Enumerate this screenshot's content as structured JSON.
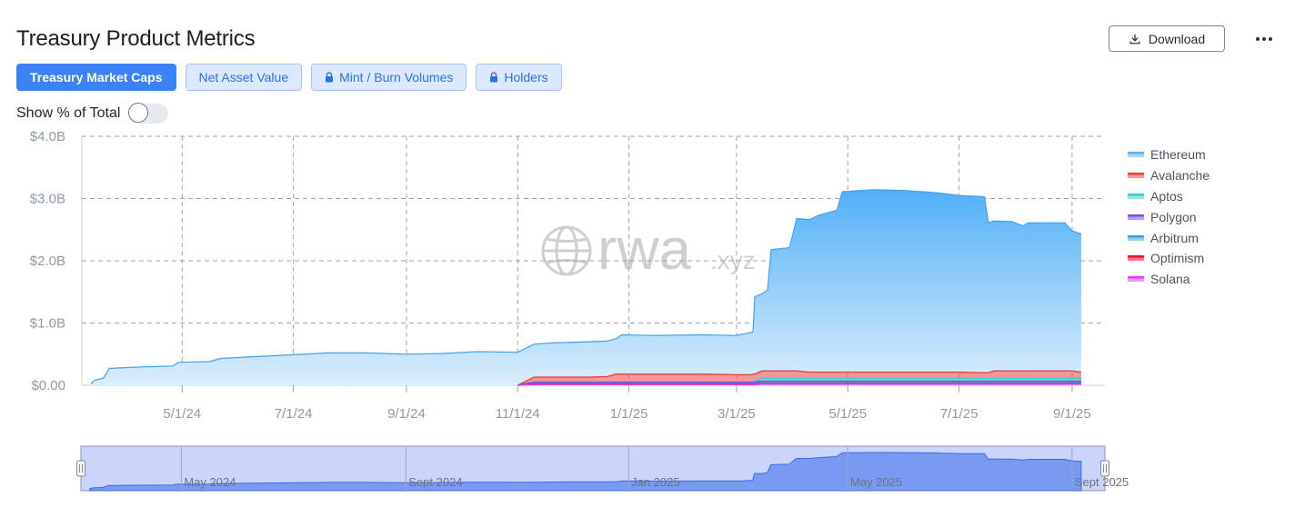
{
  "header": {
    "title": "Treasury Product Metrics",
    "download_label": "Download"
  },
  "tabs": [
    {
      "label": "Treasury Market Caps",
      "active": true,
      "locked": false
    },
    {
      "label": "Net Asset Value",
      "active": false,
      "locked": false
    },
    {
      "label": "Mint / Burn Volumes",
      "active": false,
      "locked": true
    },
    {
      "label": "Holders",
      "active": false,
      "locked": true
    }
  ],
  "toggle": {
    "label": "Show % of Total",
    "on": false
  },
  "watermark": {
    "main": "rwa",
    "suffix": ".xyz"
  },
  "colors": {
    "accent": "#3b82f6",
    "Ethereum": "#5db1f2",
    "Avalanche": "#e84142",
    "Aptos": "#2dd4bf",
    "Polygon": "#7b4fd8",
    "Arbitrum": "#28a0f0",
    "Optimism": "#ff0420",
    "Solana": "#e040fb",
    "navigator": "#6c8ff0"
  },
  "chart_data": {
    "type": "area",
    "stacked": true,
    "title": "",
    "xlabel": "",
    "ylabel": "",
    "y_ticks": [
      "$0.00",
      "$1.0B",
      "$2.0B",
      "$3.0B",
      "$4.0B"
    ],
    "ylim": [
      0,
      4.0
    ],
    "y_unit": "billion USD",
    "xlim": [
      "2024-03-07",
      "2025-09-19"
    ],
    "x_ticks": [
      {
        "date": "2024-05-01",
        "label": "5/1/24"
      },
      {
        "date": "2024-07-01",
        "label": "7/1/24"
      },
      {
        "date": "2024-09-01",
        "label": "9/1/24"
      },
      {
        "date": "2024-11-01",
        "label": "11/1/24"
      },
      {
        "date": "2025-01-01",
        "label": "1/1/25"
      },
      {
        "date": "2025-03-01",
        "label": "3/1/25"
      },
      {
        "date": "2025-05-01",
        "label": "5/1/25"
      },
      {
        "date": "2025-07-01",
        "label": "7/1/25"
      },
      {
        "date": "2025-09-01",
        "label": "9/1/25"
      }
    ],
    "grid": true,
    "legend_position": "right",
    "series": [
      {
        "name": "Ethereum",
        "points": [
          [
            "2024-03-12",
            0.02
          ],
          [
            "2024-03-14",
            0.08
          ],
          [
            "2024-03-19",
            0.12
          ],
          [
            "2024-03-22",
            0.27
          ],
          [
            "2024-04-05",
            0.29
          ],
          [
            "2024-04-26",
            0.31
          ],
          [
            "2024-04-29",
            0.37
          ],
          [
            "2024-05-16",
            0.38
          ],
          [
            "2024-05-22",
            0.43
          ],
          [
            "2024-06-10",
            0.46
          ],
          [
            "2024-07-01",
            0.49
          ],
          [
            "2024-07-20",
            0.52
          ],
          [
            "2024-08-10",
            0.52
          ],
          [
            "2024-09-01",
            0.5
          ],
          [
            "2024-09-20",
            0.51
          ],
          [
            "2024-10-10",
            0.54
          ],
          [
            "2024-11-01",
            0.53
          ],
          [
            "2024-11-20",
            0.55
          ],
          [
            "2024-12-10",
            0.57
          ],
          [
            "2024-12-28",
            0.63
          ],
          [
            "2025-01-15",
            0.62
          ],
          [
            "2025-02-10",
            0.63
          ],
          [
            "2025-03-01",
            0.63
          ],
          [
            "2025-03-09",
            0.68
          ],
          [
            "2025-03-11",
            1.24
          ],
          [
            "2025-03-18",
            1.3
          ],
          [
            "2025-03-20",
            1.95
          ],
          [
            "2025-03-30",
            1.98
          ],
          [
            "2025-04-03",
            2.45
          ],
          [
            "2025-04-15",
            2.52
          ],
          [
            "2025-04-25",
            2.6
          ],
          [
            "2025-04-28",
            2.9
          ],
          [
            "2025-05-15",
            2.93
          ],
          [
            "2025-06-01",
            2.92
          ],
          [
            "2025-06-20",
            2.88
          ],
          [
            "2025-07-01",
            2.84
          ],
          [
            "2025-07-15",
            2.83
          ],
          [
            "2025-07-17",
            2.41
          ],
          [
            "2025-07-30",
            2.4
          ],
          [
            "2025-08-05",
            2.33
          ],
          [
            "2025-08-08",
            2.38
          ],
          [
            "2025-08-28",
            2.38
          ],
          [
            "2025-09-01",
            2.25
          ],
          [
            "2025-09-06",
            2.22
          ]
        ]
      },
      {
        "name": "Avalanche",
        "points": [
          [
            "2024-11-01",
            0.0
          ],
          [
            "2024-11-10",
            0.08
          ],
          [
            "2024-12-20",
            0.09
          ],
          [
            "2024-12-25",
            0.13
          ],
          [
            "2025-03-01",
            0.12
          ],
          [
            "2025-03-15",
            0.12
          ],
          [
            "2025-04-10",
            0.1
          ],
          [
            "2025-07-15",
            0.09
          ],
          [
            "2025-07-20",
            0.12
          ],
          [
            "2025-09-06",
            0.1
          ]
        ]
      },
      {
        "name": "Aptos",
        "points": [
          [
            "2024-11-01",
            0.0
          ],
          [
            "2024-11-10",
            0.0
          ],
          [
            "2025-03-10",
            0.01
          ],
          [
            "2025-03-15",
            0.04
          ],
          [
            "2025-09-06",
            0.04
          ]
        ]
      },
      {
        "name": "Polygon",
        "points": [
          [
            "2024-11-01",
            0.0
          ],
          [
            "2024-11-10",
            0.02
          ],
          [
            "2025-09-06",
            0.02
          ]
        ]
      },
      {
        "name": "Arbitrum",
        "points": [
          [
            "2024-11-01",
            0.0
          ],
          [
            "2024-11-10",
            0.01
          ],
          [
            "2025-03-15",
            0.02
          ],
          [
            "2025-09-06",
            0.02
          ]
        ]
      },
      {
        "name": "Optimism",
        "points": [
          [
            "2024-11-01",
            0.0
          ],
          [
            "2024-11-10",
            0.01
          ],
          [
            "2025-09-06",
            0.01
          ]
        ]
      },
      {
        "name": "Solana",
        "points": [
          [
            "2024-11-01",
            0.0
          ],
          [
            "2024-11-10",
            0.01
          ],
          [
            "2025-03-15",
            0.02
          ],
          [
            "2025-09-06",
            0.02
          ]
        ]
      }
    ],
    "navigator": {
      "labels": [
        {
          "date": "2024-05-01",
          "label": "May 2024"
        },
        {
          "date": "2024-09-01",
          "label": "Sept 2024"
        },
        {
          "date": "2025-01-01",
          "label": "Jan 2025"
        },
        {
          "date": "2025-05-01",
          "label": "May 2025"
        },
        {
          "date": "2025-09-01",
          "label": "Sept 2025"
        }
      ]
    }
  }
}
